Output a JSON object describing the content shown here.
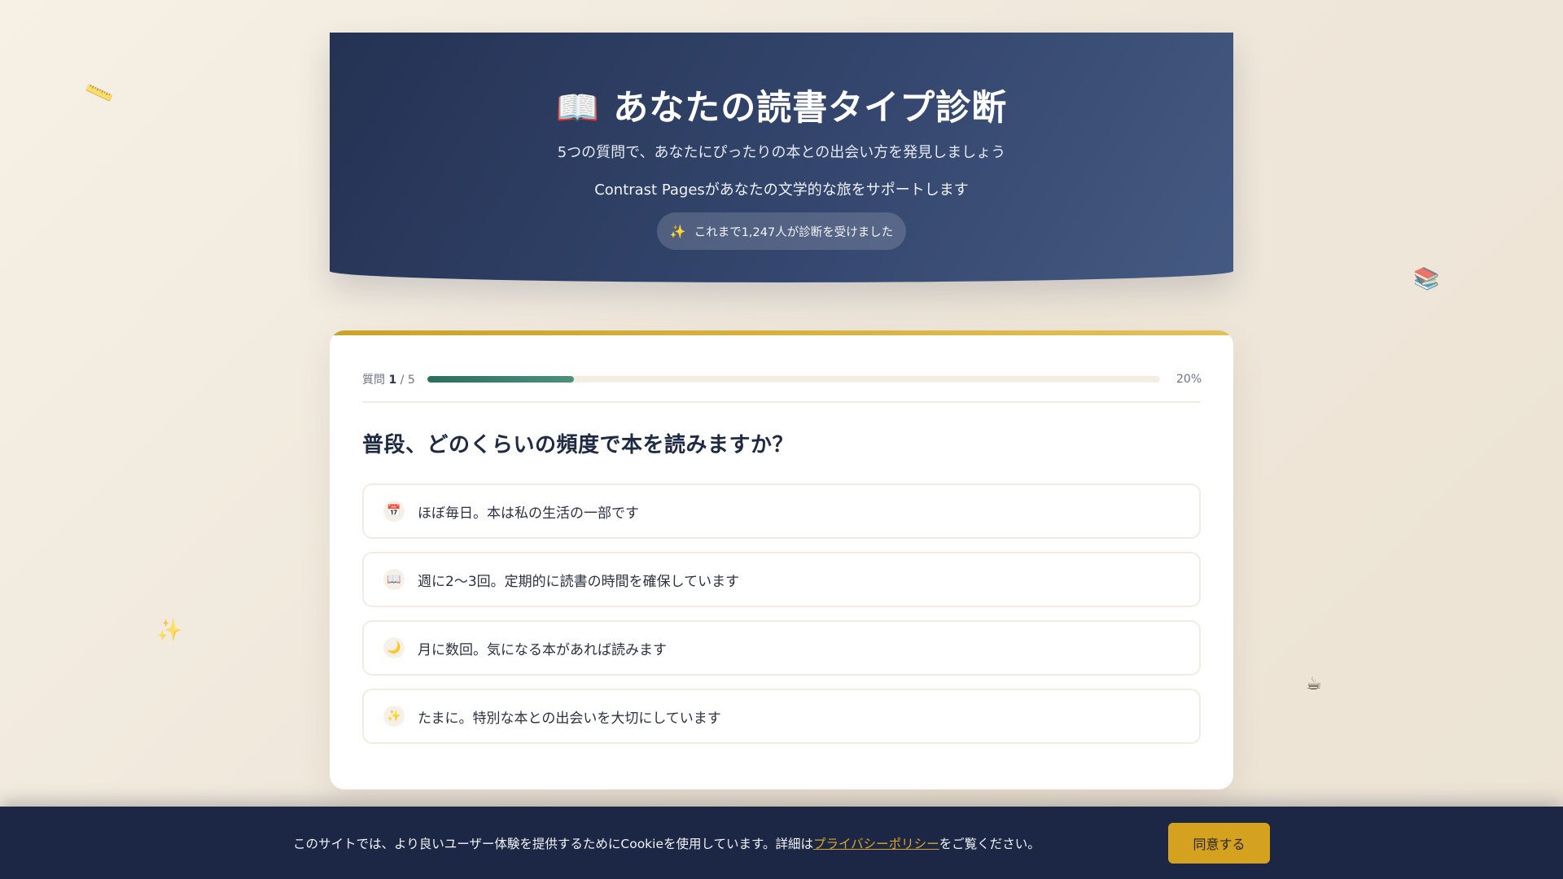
{
  "decorations": {
    "ruler": "📏",
    "books": "📚",
    "sparkles": "✨",
    "coffee": "☕"
  },
  "header": {
    "title_icon": "📖",
    "title": "あなたの読書タイプ診断",
    "subtitle": "5つの質問で、あなたにぴったりの本との出会い方を発見しましょう",
    "tagline": "Contrast Pagesがあなたの文学的な旅をサポートします",
    "badge_icon": "✨",
    "badge_text": "これまで1,247人が診断を受けました"
  },
  "quiz": {
    "progress": {
      "label_prefix": "質問",
      "current": "1",
      "separator": "/ 5",
      "percent_text": "20%",
      "fraction": 0.2
    },
    "question": "普段、どのくらいの頻度で本を読みますか？",
    "options": [
      {
        "icon": "📅",
        "label": "ほぼ毎日。本は私の生活の一部です"
      },
      {
        "icon": "📖",
        "label": "週に2〜3回。定期的に読書の時間を確保しています"
      },
      {
        "icon": "🌙",
        "label": "月に数回。気になる本があれば読みます"
      },
      {
        "icon": "✨",
        "label": "たまに。特別な本との出会いを大切にしています"
      }
    ]
  },
  "cookie": {
    "text_before": "このサイトでは、より良いユーザー体験を提供するためにCookieを使用しています。詳細は",
    "link_text": "プライバシーポリシー",
    "text_after": "をご覧ください。",
    "accept_label": "同意する"
  },
  "colors": {
    "header_bg": "#2c3a5e",
    "accent_gold": "#d4a21f",
    "progress_green": "#2c6e5a",
    "cookie_bg": "#1c2745"
  }
}
